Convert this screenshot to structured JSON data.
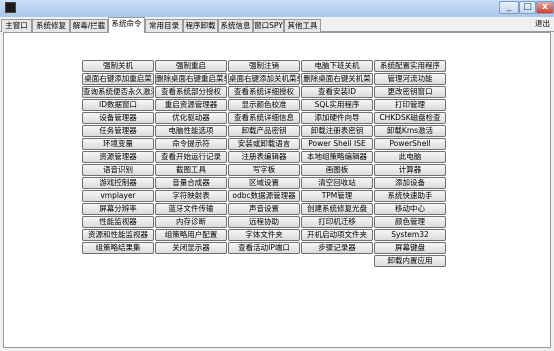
{
  "window": {
    "close_glyph": "x",
    "min_glyph": "_",
    "max_glyph": "□"
  },
  "tabs": [
    "主窗口",
    "系统修复",
    "解毒/拦截",
    "系统命令",
    "常用目录",
    "程序卸载",
    "系统信息",
    "窗口SPY",
    "其他工具"
  ],
  "active_tab": "系统命令",
  "exit_label": "退出",
  "rows": [
    [
      "强制关机",
      "强制重启",
      "强制注销",
      "电脑下班关机",
      "系统配置实用程序"
    ],
    [
      "桌面右键添加重启菜",
      "删除桌面右键重启菜单",
      "桌面右键添加关机菜单",
      "删除桌面右键关机菜",
      "管理河流功能"
    ],
    [
      "查询系统便否永久激活",
      "查看系统部分授权",
      "查看系统详细授权",
      "查看安装ID",
      "更改密钥窗口"
    ],
    [
      "ID数据窗口",
      "重启资源管理器",
      "显示颜色校准",
      "SQL实用程序",
      "打印管理"
    ],
    [
      "设备管理器",
      "优化驱动器",
      "查看系统详细信息",
      "添加硬件向导",
      "CHKDSK磁盘检查"
    ],
    [
      "任务管理器",
      "电脑性能选项",
      "卸载产品密钥",
      "卸载注册表密钥",
      "卸载Kms激活"
    ],
    [
      "环境变量",
      "命令提示符",
      "安装或卸载语言",
      "Power Shell ISE",
      "PowerShell"
    ],
    [
      "资源管理器",
      "查看开始运行记录",
      "注册表编辑器",
      "本地组策略编辑器",
      "此电脑"
    ],
    [
      "语音识别",
      "截图工具",
      "写字板",
      "画图板",
      "计算器"
    ],
    [
      "游戏控制器",
      "音量合成器",
      "区域设置",
      "清空回收站",
      "添加设备"
    ],
    [
      "vmplayer",
      "字符映射表",
      "odbc数据源管理器",
      "TPM管理",
      "系统快速助手"
    ],
    [
      "屏幕分辨率",
      "蓝牙文件传输",
      "声音设置",
      "创建系统修复光盘",
      "移动中心"
    ],
    [
      "性能监视器",
      "内存诊断",
      "远程协助",
      "打印机迁移",
      "颜色管理"
    ],
    [
      "资源和性能监视器",
      "组策略用户配置",
      "字体文件夹",
      "开机启动项文件夹",
      "System32"
    ],
    [
      "组策略结果集",
      "关闭显示器",
      "查看活动IP端口",
      "步骤记录器",
      "屏幕键盘"
    ],
    [
      "",
      "",
      "",
      "",
      "卸载内置应用"
    ]
  ]
}
